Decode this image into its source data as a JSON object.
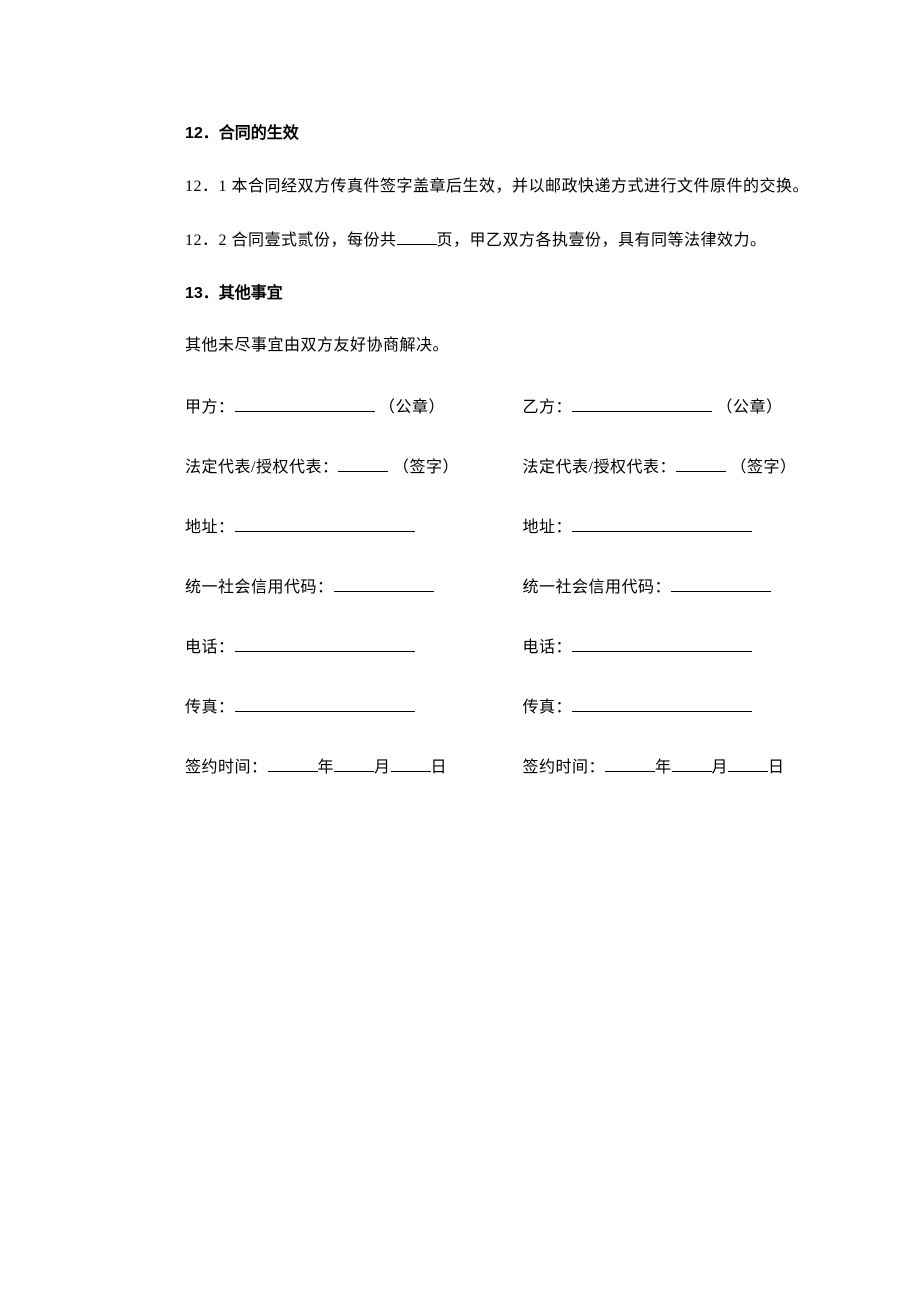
{
  "section12": {
    "heading": "12．合同的生效",
    "p1_prefix": "12．1 本合同经双方传真件签字盖章后生效，并以邮政快递方式进行文件原件的交换。",
    "p2_prefix": "12．2 合同壹式贰份，每份共",
    "p2_suffix": "页，甲乙双方各执壹份，具有同等法律效力。"
  },
  "section13": {
    "heading": "13．其他事宜",
    "p1": "其他未尽事宜由双方友好协商解决。"
  },
  "signature": {
    "partyA": {
      "name_label": "甲方：",
      "name_suffix": "（公章）",
      "rep_label": "法定代表/授权代表：",
      "rep_suffix": "（签字）",
      "address_label": "地址：",
      "credit_label": "统一社会信用代码：",
      "phone_label": "电话：",
      "fax_label": "传真：",
      "date_label": "签约时间：",
      "year": "年",
      "month": "月",
      "day": "日"
    },
    "partyB": {
      "name_label": "乙方：",
      "name_suffix": "（公章）",
      "rep_label": "法定代表/授权代表：",
      "rep_suffix": "（签字）",
      "address_label": "地址：",
      "credit_label": "统一社会信用代码：",
      "phone_label": "电话：",
      "fax_label": "传真：",
      "date_label": "签约时间：",
      "year": "年",
      "month": "月",
      "day": "日"
    }
  }
}
